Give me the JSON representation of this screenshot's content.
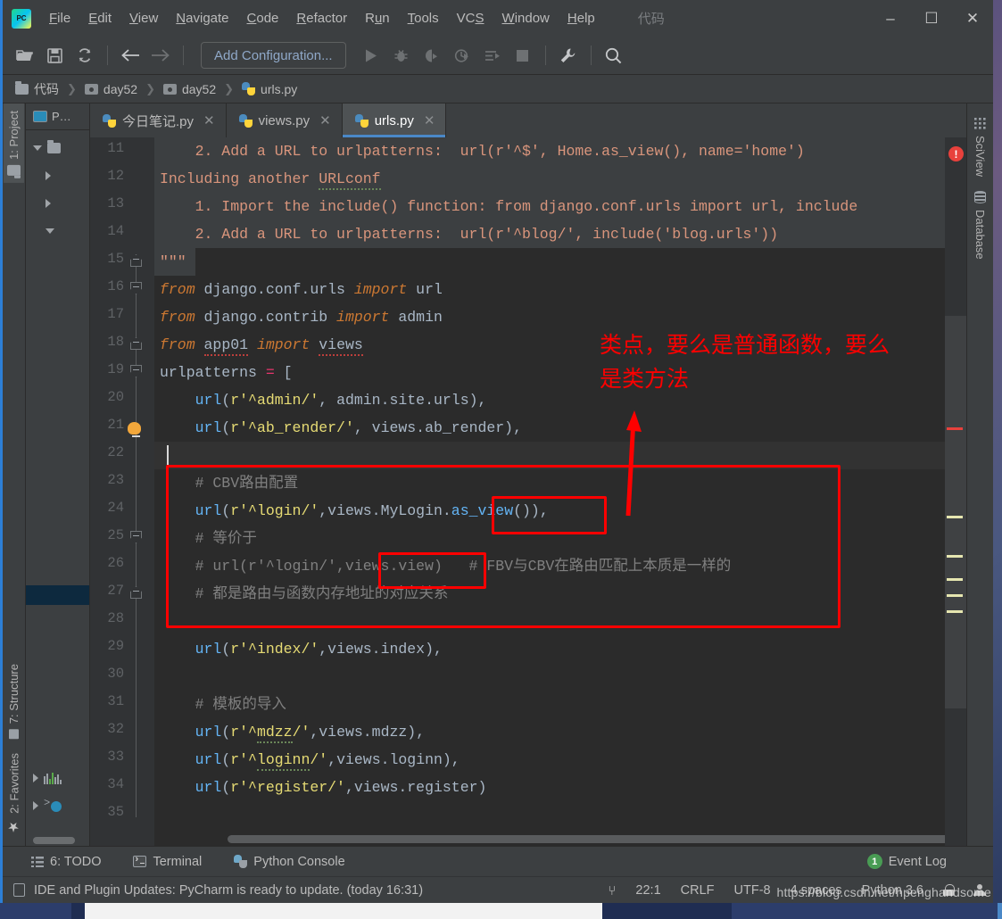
{
  "window": {
    "app_name": "PyCharm",
    "logo_text": "PC",
    "extra_label": "代码",
    "minimize": "–",
    "maximize": "☐",
    "close": "✕"
  },
  "menu": [
    {
      "label": "File",
      "accel": "F"
    },
    {
      "label": "Edit",
      "accel": "E"
    },
    {
      "label": "View",
      "accel": "V"
    },
    {
      "label": "Navigate",
      "accel": "N"
    },
    {
      "label": "Code",
      "accel": "C"
    },
    {
      "label": "Refactor",
      "accel": "R"
    },
    {
      "label": "Run",
      "accel": "R"
    },
    {
      "label": "Tools",
      "accel": "T"
    },
    {
      "label": "VCS",
      "accel": "S"
    },
    {
      "label": "Window",
      "accel": "W"
    },
    {
      "label": "Help",
      "accel": "H"
    }
  ],
  "toolbar": {
    "run_config_label": "Add Configuration...",
    "icons": [
      "open-folder-icon",
      "save-all-icon",
      "sync-refresh-icon",
      "back-arrow-icon",
      "forward-arrow-icon",
      "run-icon",
      "debug-icon",
      "run-coverage-icon",
      "profile-icon",
      "run-with-console-icon",
      "stop-icon",
      "settings-wrench-icon",
      "search-icon"
    ]
  },
  "breadcrumb": [
    {
      "label": "代码",
      "icon": "folder-icon"
    },
    {
      "label": "day52",
      "icon": "module-icon"
    },
    {
      "label": "day52",
      "icon": "module-icon"
    },
    {
      "label": "urls.py",
      "icon": "python-file-icon"
    }
  ],
  "left_strip": {
    "top_tabs": [
      {
        "label": "1: Project",
        "icon": "folder-icon",
        "active": true
      }
    ],
    "bottom_tabs": [
      {
        "label": "7: Structure",
        "icon": "structure-icon"
      },
      {
        "label": "2: Favorites",
        "icon": "star-icon"
      }
    ]
  },
  "project_pane": {
    "title": "P…"
  },
  "right_strip": [
    {
      "label": "SciView",
      "icon": "grid-icon"
    },
    {
      "label": "Database",
      "icon": "database-icon"
    }
  ],
  "editor_tabs": [
    {
      "label": "今日笔记.py",
      "active": false,
      "close": "✕"
    },
    {
      "label": "views.py",
      "active": false,
      "close": "✕"
    },
    {
      "label": "urls.py",
      "active": true,
      "close": "✕"
    }
  ],
  "code": {
    "first_line": 11,
    "lines": [
      {
        "n": 11,
        "text": "    2. Add a URL to urlpatterns:  url(r'^$', Home.as_view(), name='home')"
      },
      {
        "n": 12,
        "text": "Including another URLconf"
      },
      {
        "n": 13,
        "text": "    1. Import the include() function: from django.conf.urls import url, include"
      },
      {
        "n": 14,
        "text": "    2. Add a URL to urlpatterns:  url(r'^blog/', include('blog.urls'))"
      },
      {
        "n": 15,
        "text": "\"\"\""
      },
      {
        "n": 16,
        "text": "from django.conf.urls import url"
      },
      {
        "n": 17,
        "text": "from django.contrib import admin"
      },
      {
        "n": 18,
        "text": "from app01 import views"
      },
      {
        "n": 19,
        "text": "urlpatterns = ["
      },
      {
        "n": 20,
        "text": "    url(r'^admin/', admin.site.urls),"
      },
      {
        "n": 21,
        "text": "    url(r'^ab_render/', views.ab_render),"
      },
      {
        "n": 22,
        "text": ""
      },
      {
        "n": 23,
        "text": "    # CBV路由配置"
      },
      {
        "n": 24,
        "text": "    url(r'^login/',views.MyLogin.as_view()),"
      },
      {
        "n": 25,
        "text": "    # 等价于"
      },
      {
        "n": 26,
        "text": "    # url(r'^login/',views.view)   # FBV与CBV在路由匹配上本质是一样的"
      },
      {
        "n": 27,
        "text": "    # 都是路由与函数内存地址的对应关系"
      },
      {
        "n": 28,
        "text": ""
      },
      {
        "n": 29,
        "text": "    url(r'^index/',views.index),"
      },
      {
        "n": 30,
        "text": ""
      },
      {
        "n": 31,
        "text": "    # 模板的导入"
      },
      {
        "n": 32,
        "text": "    url(r'^mdzz/',views.mdzz),"
      },
      {
        "n": 33,
        "text": "    url(r'^loginn/',views.loginn),"
      },
      {
        "n": 34,
        "text": "    url(r'^register/',views.register)"
      },
      {
        "n": 35,
        "text": ""
      }
    ]
  },
  "annotations": {
    "note_text": "类点，要么是普通函数，要么\n是类方法",
    "color": "#fe0000",
    "boxes": [
      "as_view-highlight-box",
      "views.view-highlight-box",
      "cbv-block-box"
    ],
    "arrow": "arrow-pointing-to-as_view"
  },
  "bottom_tools": [
    {
      "label": "6: TODO",
      "accel": "6",
      "icon": "todo-list-icon"
    },
    {
      "label": "Terminal",
      "icon": "terminal-icon"
    },
    {
      "label": "Python Console",
      "icon": "python-console-icon"
    }
  ],
  "event_log": {
    "label": "Event Log",
    "count": "1"
  },
  "status_bar": {
    "message": "IDE and Plugin Updates: PyCharm is ready to update. (today 16:31)",
    "vcs_icon": "vcs-branch-icon",
    "caret_position": "22:1",
    "line_separator": "CRLF",
    "encoding": "UTF-8",
    "indent": "4 spaces",
    "interpreter": "Python 3.6",
    "lock_icon": "lock-icon",
    "account_icon": "account-icon"
  },
  "watermark": "https://blog.csdn.net/hpenghandsome",
  "colors": {
    "accent": "#4a88c7",
    "annotation_red": "#fe0000",
    "editor_bg": "#2b2b2b",
    "chrome_bg": "#3c3f41",
    "gutter_bg": "#313335",
    "error_red": "#e8413c",
    "event_green": "#499c54"
  }
}
